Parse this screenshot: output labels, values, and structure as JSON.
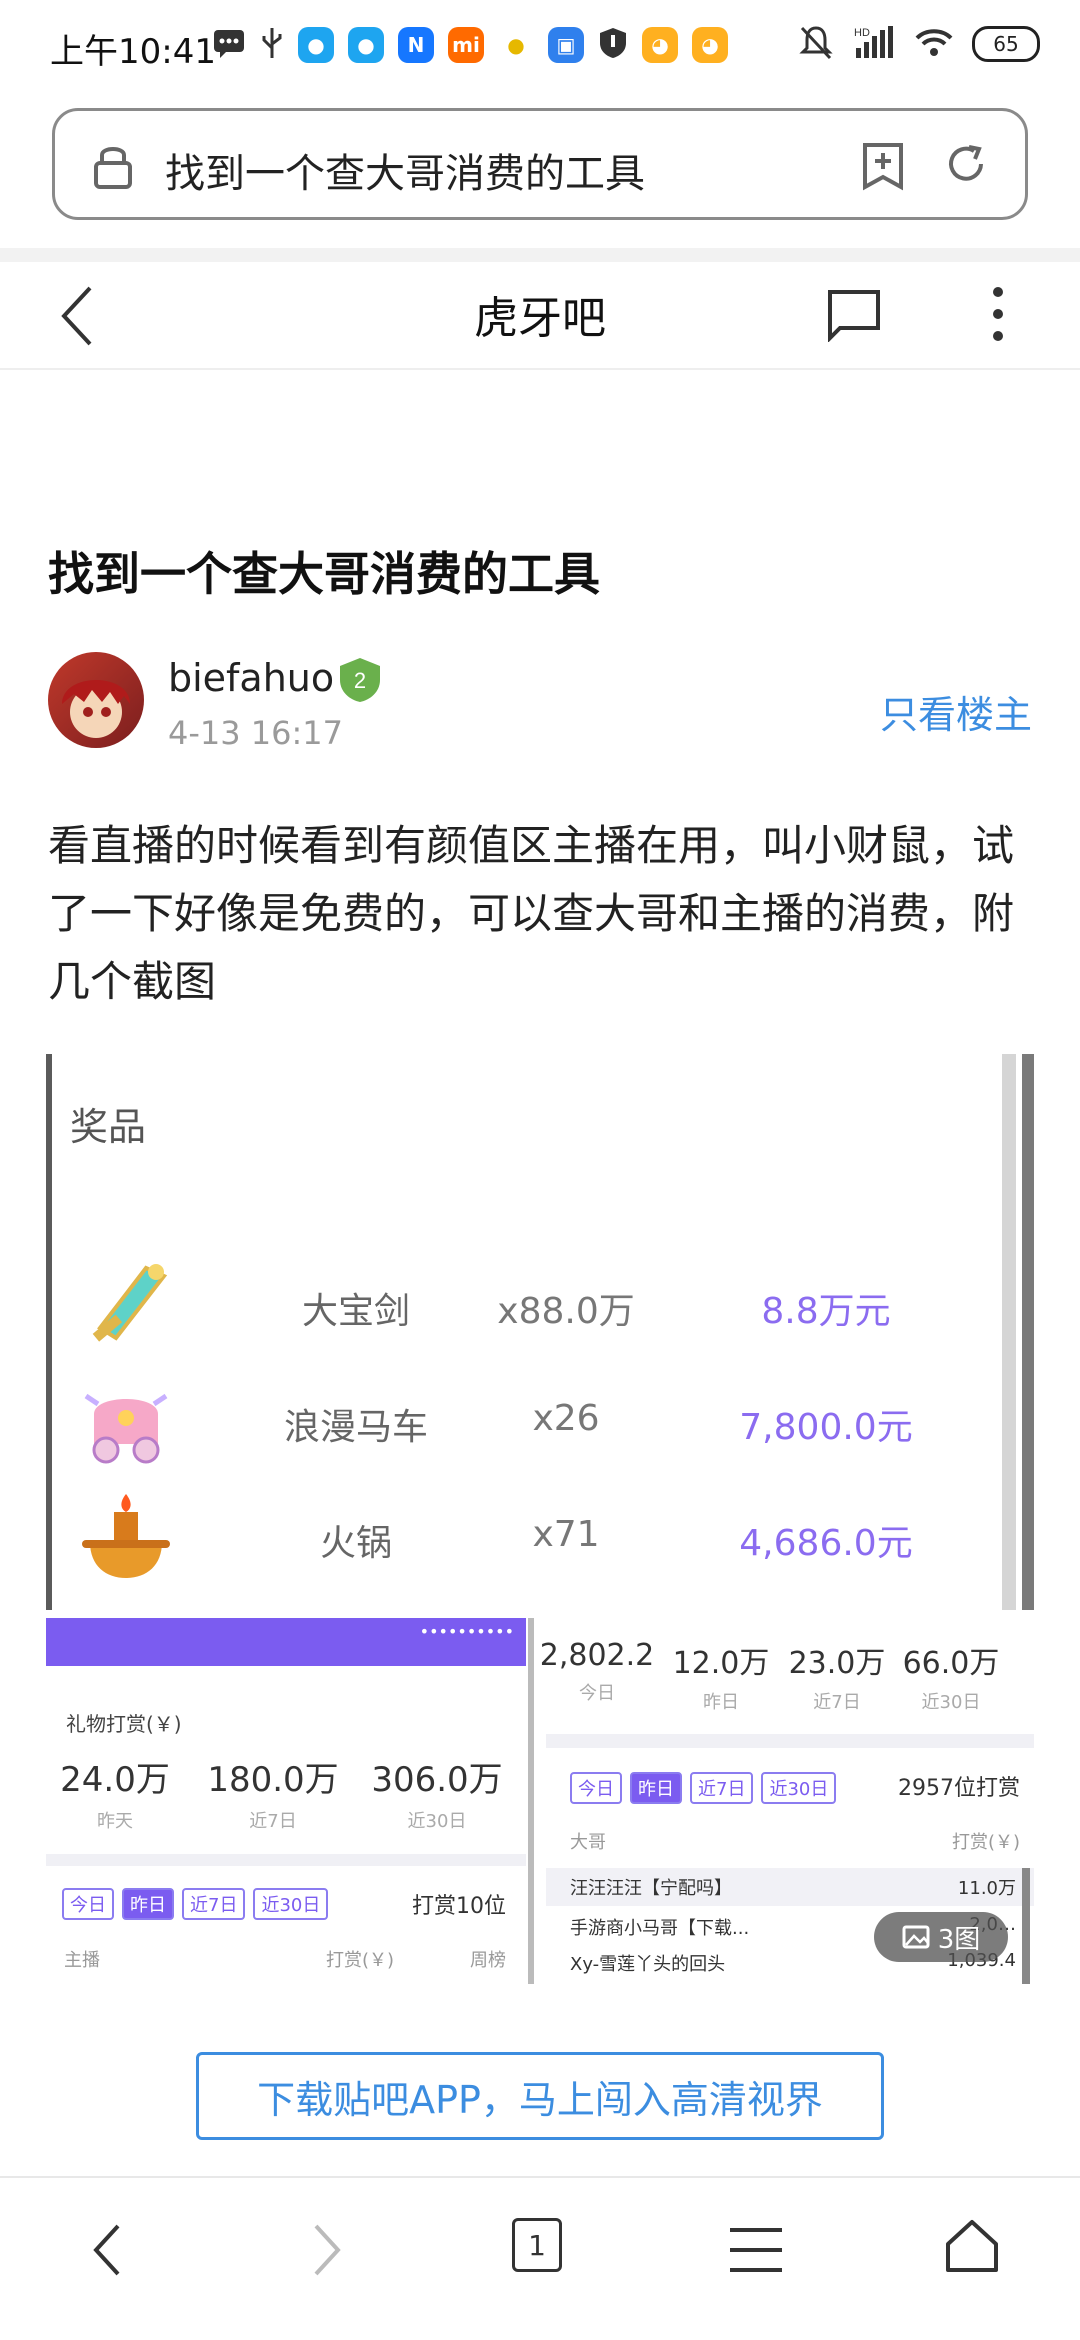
{
  "status_bar": {
    "time": "上午10:41",
    "battery": "65",
    "hd_label": "HD"
  },
  "url_bar": {
    "text": "找到一个查大哥消费的工具"
  },
  "nav": {
    "title": "虎牙吧"
  },
  "post": {
    "title": "找到一个查大哥消费的工具",
    "author": "biefahuo",
    "level": "2",
    "time": "4-13 16:17",
    "only_owner": "只看楼主",
    "body": "看直播的时候看到有颜值区主播在用，叫小财鼠，试了一下好像是免费的，可以查大哥和主播的消费，附几个截图"
  },
  "image1": {
    "header": "奖品",
    "prizes": [
      {
        "name": "大宝剑",
        "count": "x88.0万",
        "price": "8.8万元"
      },
      {
        "name": "浪漫马车",
        "count": "x26",
        "price": "7,800.0元"
      },
      {
        "name": "火锅",
        "count": "x71",
        "price": "4,686.0元"
      }
    ]
  },
  "image2": {
    "dots": "••••••••••",
    "section_label": "礼物打赏(￥)",
    "stats": [
      {
        "value": "24.0万",
        "label": "昨天"
      },
      {
        "value": "180.0万",
        "label": "近7日"
      },
      {
        "value": "306.0万",
        "label": "近30日"
      }
    ],
    "pills": [
      "今日",
      "昨日",
      "近7日",
      "近30日"
    ],
    "rank_title": "打赏10位",
    "col_anchor": "主播",
    "col_amount": "打赏(￥)",
    "col_week": "周榜"
  },
  "image3": {
    "stats": [
      {
        "value": "2,802.2",
        "label": "今日"
      },
      {
        "value": "12.0万",
        "label": "昨日"
      },
      {
        "value": "23.0万",
        "label": "近7日"
      },
      {
        "value": "66.0万",
        "label": "近30日"
      }
    ],
    "pills": [
      "今日",
      "昨日",
      "近7日",
      "近30日"
    ],
    "rank_title": "2957位打赏",
    "col_user": "大哥",
    "col_amount": "打赏(￥)",
    "rows": [
      {
        "name": "汪汪汪汪【宁配吗】",
        "amount": "11.0万"
      },
      {
        "name": "手游商小马哥【下载...",
        "amount": "2,0…"
      },
      {
        "name": "Xy-雪莲丫头的回头",
        "amount": "1,039.4"
      }
    ]
  },
  "image_badge": "3图",
  "download_button": "下载贴吧APP，马上闯入高清视界",
  "bottom_bar": {
    "tab_count": "1"
  },
  "colors": {
    "link_blue": "#3c8de0",
    "purple": "#7b5cf0"
  }
}
